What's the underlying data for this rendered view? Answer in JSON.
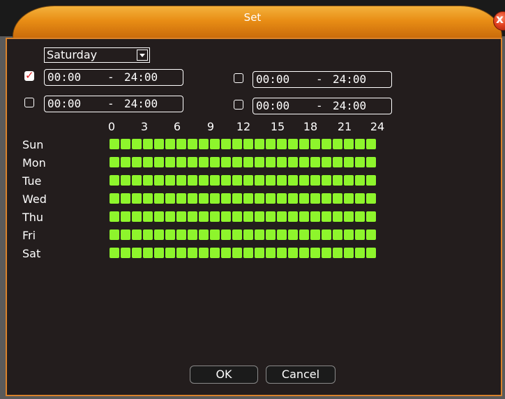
{
  "window": {
    "title": "Set",
    "close_label": "x"
  },
  "day_select": {
    "value": "Saturday"
  },
  "periods": [
    {
      "enabled": true,
      "start": "00:00",
      "sep": "-",
      "end": "24:00"
    },
    {
      "enabled": false,
      "start": "00:00",
      "sep": "-",
      "end": "24:00"
    },
    {
      "enabled": false,
      "start": "00:00",
      "sep": "-",
      "end": "24:00"
    },
    {
      "enabled": false,
      "start": "00:00",
      "sep": "-",
      "end": "24:00"
    }
  ],
  "timeline": {
    "hour_labels": [
      "0",
      "3",
      "6",
      "9",
      "12",
      "15",
      "18",
      "21",
      "24"
    ],
    "days": [
      "Sun",
      "Mon",
      "Tue",
      "Wed",
      "Thu",
      "Fri",
      "Sat"
    ],
    "segments_per_day": 24,
    "active_color": "#8ef52c"
  },
  "buttons": {
    "ok": "OK",
    "cancel": "Cancel"
  },
  "colors": {
    "title_bar": "#e88d15",
    "panel_border": "#d9822b",
    "panel_bg": "#231d1d",
    "checkmark": "#e02020"
  }
}
